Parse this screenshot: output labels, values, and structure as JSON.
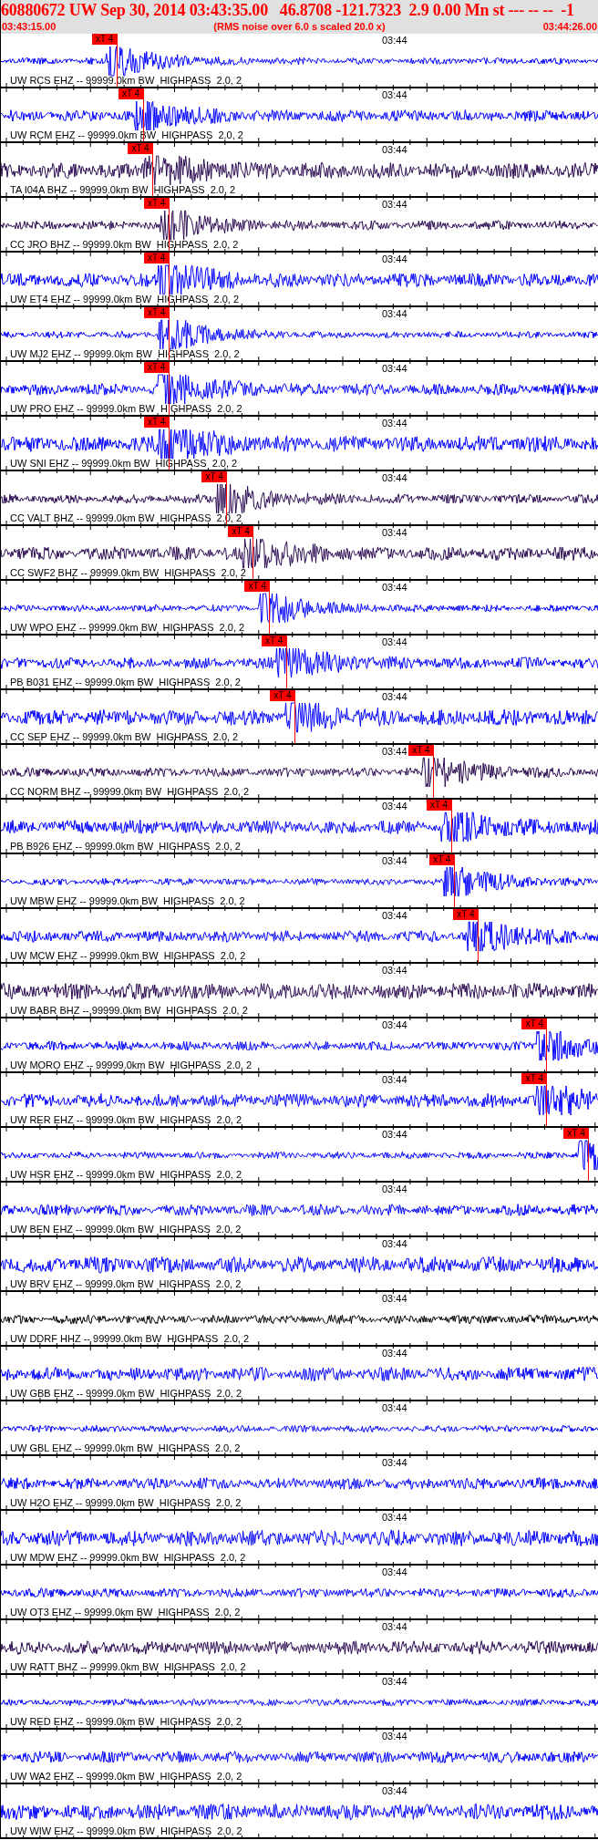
{
  "header": {
    "title": "60880672 UW Sep 30, 2014 03:43:35.00   46.8708 -121.7323  2.9 0.00 Mn st --- -- --  -1",
    "start_time": "03:43:15.00",
    "note": "(RMS noise over 6.0 s scaled 20.0 x)",
    "end_time": "03:44:26.00"
  },
  "traces": [
    {
      "label": "UW RCS EHZ -- 99999.0km BW  HIGHPASS  2.0, 2",
      "tick_label": "03:44",
      "color": "#0000ff",
      "pick": {
        "label": "xT 4",
        "level": 0.195
      }
    },
    {
      "label": "UW RCM EHZ -- 99999.0km BW  HIGHPASS  2.0, 2",
      "tick_label": "03:44",
      "color": "#0000ff",
      "pick": {
        "label": "xT 4",
        "level": 0.239
      }
    },
    {
      "label": "TA I04A BHZ -- 99999.0km BW  HIGHPASS  2.0, 2",
      "tick_label": "03:44",
      "color": "#2a0a50",
      "pick": {
        "label": "xT 4",
        "level": 0.255
      }
    },
    {
      "label": "CC JRO BHZ -- 99999.0km BW  HIGHPASS  2.0, 2",
      "tick_label": "03:44",
      "color": "#2a0a50",
      "pick": {
        "label": "xT 4",
        "level": 0.282
      }
    },
    {
      "label": "UW ET4 EHZ -- 99999.0km BW  HIGHPASS  2.0, 2",
      "tick_label": "03:44",
      "color": "#0000ff",
      "pick": {
        "label": "xT 4",
        "level": 0.282
      }
    },
    {
      "label": "UW MJ2 EHZ -- 99999.0km BW  HIGHPASS  2.0, 2",
      "tick_label": "03:44",
      "color": "#0000ff",
      "pick": {
        "label": "xT 4",
        "level": 0.282
      }
    },
    {
      "label": "UW PRO EHZ -- 99999.0km BW  HIGHPASS  2.0, 2",
      "tick_label": "03:44",
      "color": "#0000ff",
      "pick": {
        "label": "xT 4",
        "level": 0.282
      }
    },
    {
      "label": "UW SNI EHZ -- 99999.0km BW  HIGHPASS  2.0, 2",
      "tick_label": "03:44",
      "color": "#0000ff",
      "pick": {
        "label": "xT 4",
        "level": 0.282
      }
    },
    {
      "label": "CC VALT BHZ -- 99999.0km BW  HIGHPASS  2.0, 2",
      "tick_label": "03:44",
      "color": "#2a0a50",
      "pick": {
        "label": "xT 4",
        "level": 0.379
      }
    },
    {
      "label": "CC SWF2 BHZ -- 99999.0km BW  HIGHPASS  2.0, 2",
      "tick_label": "03:44",
      "color": "#2a0a50",
      "pick": {
        "label": "xT 4",
        "level": 0.423
      }
    },
    {
      "label": "UW WPO EHZ -- 99999.0km BW  HIGHPASS  2.0, 2",
      "tick_label": "03:44",
      "color": "#0000ff",
      "pick": {
        "label": "xT 4",
        "level": 0.451
      }
    },
    {
      "label": "PB B031 EHZ -- 99999.0km BW  HIGHPASS  2.0, 2",
      "tick_label": "03:44",
      "color": "#0000ff",
      "pick": {
        "label": "xT 4",
        "level": 0.479
      }
    },
    {
      "label": "CC SEP EHZ -- 99999.0km BW  HIGHPASS  2.0, 2",
      "tick_label": "03:44",
      "color": "#0000ff",
      "pick": {
        "label": "xT 4",
        "level": 0.493
      }
    },
    {
      "label": "CC NORM BHZ -- 99999.0km BW  HIGHPASS  2.0, 2",
      "tick_label": "03:44",
      "color": "#2a0a50",
      "pick": {
        "label": "xT 4",
        "level": 0.725
      }
    },
    {
      "label": "PB B926 EHZ -- 99999.0km BW  HIGHPASS  2.0, 2",
      "tick_label": "03:44",
      "color": "#0000ff",
      "pick": {
        "label": "xT 4",
        "level": 0.755
      }
    },
    {
      "label": "UW MBW EHZ -- 99999.0km BW  HIGHPASS  2.0, 2",
      "tick_label": "03:44",
      "color": "#0000ff",
      "pick": {
        "label": "xT 4",
        "level": 0.76
      }
    },
    {
      "label": "UW MCW EHZ -- 99999.0km BW  HIGHPASS  2.0, 2",
      "tick_label": "03:44",
      "color": "#0000ff",
      "pick": {
        "label": "xT 4",
        "level": 0.8
      }
    },
    {
      "label": "UW BABR BHZ -- 99999.0km BW  HIGHPASS  2.0, 2",
      "tick_label": "03:44",
      "color": "#2a0a50"
    },
    {
      "label": "UW MORO EHZ -- 99999.0km BW  HIGHPASS  2.0, 2",
      "tick_label": "03:44",
      "color": "#0000ff",
      "pick": {
        "label": "xT 4",
        "level": 0.915
      }
    },
    {
      "label": "UW RER EHZ -- 99999.0km BW  HIGHPASS  2.0, 2",
      "tick_label": "03:44",
      "color": "#0000ff",
      "pick": {
        "label": "xT 4",
        "level": 0.915
      }
    },
    {
      "label": "UW HSR EHZ -- 99999.0km BW  HIGHPASS  2.0, 2",
      "tick_label": "03:44",
      "color": "#0000ff",
      "pick": {
        "label": "xT 4",
        "level": 0.985
      }
    },
    {
      "label": "UW BEN EHZ -- 99999.0km BW  HIGHPASS  2.0, 2",
      "tick_label": "03:44",
      "color": "#0000ff"
    },
    {
      "label": "UW BRV EHZ -- 99999.0km BW  HIGHPASS  2.0, 2",
      "tick_label": "03:44",
      "color": "#0000ff"
    },
    {
      "label": "UW DDRF HHZ -- 99999.0km BW  HIGHPASS  2.0, 2",
      "tick_label": "03:44",
      "color": "#000000"
    },
    {
      "label": "UW GBB EHZ -- 99999.0km BW  HIGHPASS  2.0, 2",
      "tick_label": "03:44",
      "color": "#0000ff"
    },
    {
      "label": "UW GBL EHZ -- 99999.0km BW  HIGHPASS  2.0, 2",
      "tick_label": "03:44",
      "color": "#0000ff"
    },
    {
      "label": "UW H2O EHZ -- 99999.0km BW  HIGHPASS  2.0, 2",
      "tick_label": "03:44",
      "color": "#0000ff"
    },
    {
      "label": "UW MDW EHZ -- 99999.0km BW  HIGHPASS  2.0, 2",
      "tick_label": "03:44",
      "color": "#0000ff"
    },
    {
      "label": "UW OT3 EHZ -- 99999.0km BW  HIGHPASS  2.0, 2",
      "tick_label": "03:44",
      "color": "#0000ff"
    },
    {
      "label": "UW RATT BHZ -- 99999.0km BW  HIGHPASS  2.0, 2",
      "tick_label": "03:44",
      "color": "#2a0a50"
    },
    {
      "label": "UW RED EHZ -- 99999.0km BW  HIGHPASS  2.0, 2",
      "tick_label": "03:44",
      "color": "#0000ff"
    },
    {
      "label": "UW WA2 EHZ -- 99999.0km BW  HIGHPASS  2.0, 2",
      "tick_label": "03:44",
      "color": "#0000ff"
    },
    {
      "label": "UW WIW EHZ -- 99999.0km BW  HIGHPASS  2.0, 2",
      "tick_label": "03:44",
      "color": "#0000ff"
    }
  ]
}
